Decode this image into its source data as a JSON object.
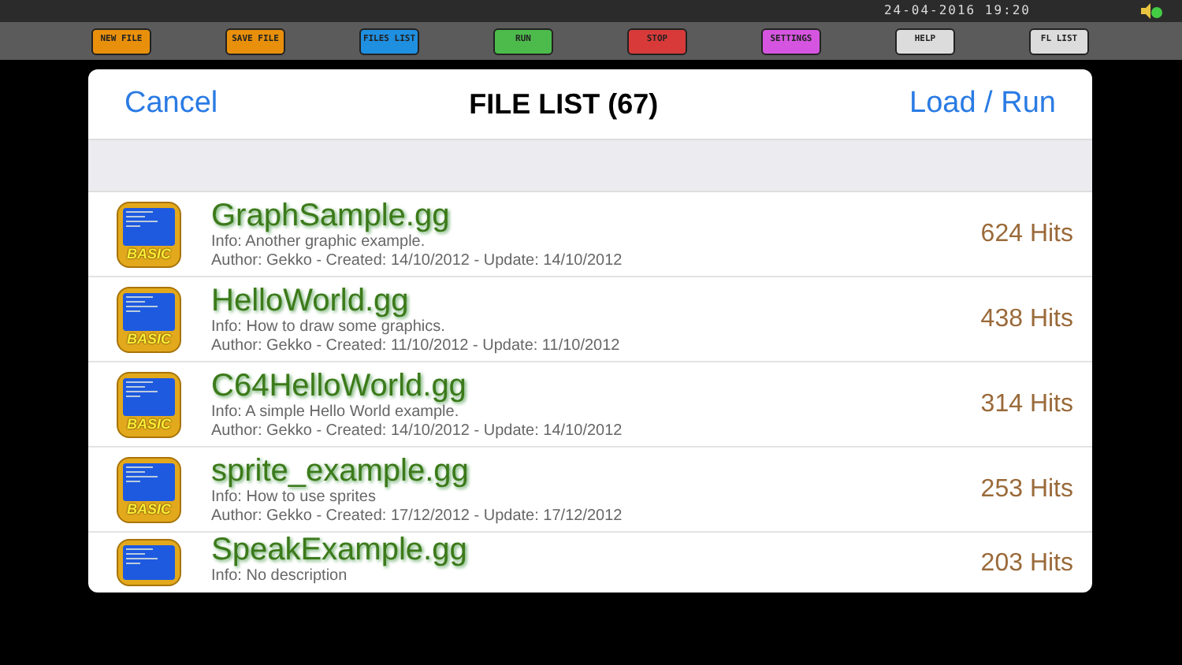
{
  "status_bar": {
    "datetime": "24-04-2016 19:20"
  },
  "toolbar": [
    {
      "label": "NEW FILE",
      "color": "#e8900c"
    },
    {
      "label": "SAVE FILE",
      "color": "#e8900c"
    },
    {
      "label": "FILES LIST",
      "color": "#1f8fe0"
    },
    {
      "label": "RUN",
      "color": "#4cbb4c"
    },
    {
      "label": "STOP",
      "color": "#d83a3a"
    },
    {
      "label": "SETTINGS",
      "color": "#d555e0"
    },
    {
      "label": "HELP",
      "color": "#dcdcdc"
    },
    {
      "label": "FL LIST",
      "color": "#dcdcdc"
    }
  ],
  "dialog": {
    "cancel": "Cancel",
    "title": "FILE LIST (67)",
    "confirm": "Load / Run"
  },
  "files": [
    {
      "name": "GraphSample.gg",
      "info": "Info: Another graphic example.",
      "author": "Author: Gekko - Created: 14/10/2012 - Update: 14/10/2012",
      "hits": "624 Hits",
      "icon_label": "BASIC"
    },
    {
      "name": "HelloWorld.gg",
      "info": "Info: How to draw some graphics.",
      "author": "Author: Gekko - Created: 11/10/2012 - Update: 11/10/2012",
      "hits": "438 Hits",
      "icon_label": "BASIC"
    },
    {
      "name": "C64HelloWorld.gg",
      "info": "Info: A simple Hello World example.",
      "author": "Author: Gekko - Created: 14/10/2012 - Update: 14/10/2012",
      "hits": "314 Hits",
      "icon_label": "BASIC"
    },
    {
      "name": "sprite_example.gg",
      "info": "Info: How to use sprites",
      "author": "Author: Gekko - Created: 17/12/2012 - Update: 17/12/2012",
      "hits": "253 Hits",
      "icon_label": "BASIC"
    },
    {
      "name": "SpeakExample.gg",
      "info": "Info: No description",
      "hits": "203 Hits"
    }
  ]
}
